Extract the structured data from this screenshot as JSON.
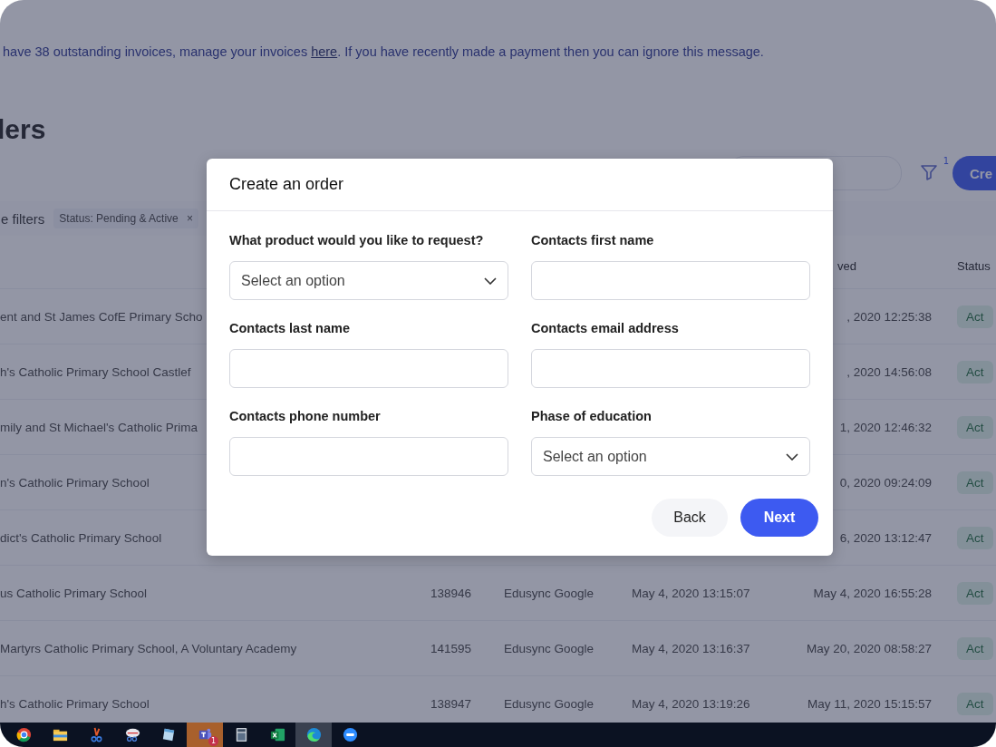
{
  "banner": {
    "text_before": "have 38 outstanding invoices, manage your invoices ",
    "link": "here",
    "text_after": ". If you have recently made a payment then you can ignore this message."
  },
  "page_title": "lers",
  "filter_button": {
    "badge": "1"
  },
  "create_button": {
    "label": "Cre"
  },
  "filters": {
    "label": "e filters",
    "chips": [
      {
        "label": "Status: Pending & Active",
        "remove": "×"
      }
    ]
  },
  "table": {
    "header": {
      "approved": "ved",
      "status": "Status"
    },
    "rows": [
      {
        "name": "ent and St James CofE Primary Scho",
        "approved": ", 2020 12:25:38",
        "status": "Act"
      },
      {
        "name": "h's Catholic Primary School Castlef",
        "approved": ", 2020 14:56:08",
        "status": "Act"
      },
      {
        "name": "mily and St Michael's Catholic Prima",
        "approved": "1, 2020 12:46:32",
        "status": "Act"
      },
      {
        "name": "n's Catholic Primary School",
        "approved": "0, 2020 09:24:09",
        "status": "Act"
      },
      {
        "name": "dict's Catholic Primary School",
        "approved": "6, 2020 13:12:47",
        "status": "Act"
      },
      {
        "name": "us Catholic Primary School",
        "id": "138946",
        "source": "Edusync Google",
        "created": "May 4, 2020 13:15:07",
        "approved": "May 4, 2020 16:55:28",
        "status": "Act"
      },
      {
        "name": "Martyrs Catholic Primary School, A Voluntary Academy",
        "id": "141595",
        "source": "Edusync Google",
        "created": "May 4, 2020 13:16:37",
        "approved": "May 20, 2020 08:58:27",
        "status": "Act"
      },
      {
        "name": "h's Catholic Primary School",
        "id": "138947",
        "source": "Edusync Google",
        "created": "May 4, 2020 13:19:26",
        "approved": "May 11, 2020 15:15:57",
        "status": "Act"
      }
    ]
  },
  "modal": {
    "title": "Create an order",
    "fields": [
      {
        "label": "What product would you like to request?",
        "kind": "select",
        "placeholder": "Select an option"
      },
      {
        "label": "Contacts first name",
        "kind": "text"
      },
      {
        "label": "Contacts last name",
        "kind": "text"
      },
      {
        "label": "Contacts email address",
        "kind": "text"
      },
      {
        "label": "Contacts phone number",
        "kind": "text"
      },
      {
        "label": "Phase of education",
        "kind": "select",
        "placeholder": "Select an option"
      }
    ],
    "buttons": [
      {
        "label": "Back",
        "kind": "secondary"
      },
      {
        "label": "Next",
        "kind": "primary"
      }
    ]
  },
  "taskbar": [
    {
      "kind": "chrome",
      "active": false,
      "flashing": false
    },
    {
      "kind": "folder",
      "active": false,
      "flashing": false
    },
    {
      "kind": "snip",
      "active": false,
      "flashing": false
    },
    {
      "kind": "scissors",
      "active": false,
      "flashing": false
    },
    {
      "kind": "notepad",
      "active": false,
      "flashing": false
    },
    {
      "kind": "teams",
      "active": false,
      "flashing": true,
      "badge": "1"
    },
    {
      "kind": "calculator",
      "active": false,
      "flashing": false
    },
    {
      "kind": "excel",
      "active": false,
      "flashing": false
    },
    {
      "kind": "edge",
      "active": true,
      "flashing": false
    },
    {
      "kind": "zoom",
      "active": false,
      "flashing": false
    }
  ]
}
